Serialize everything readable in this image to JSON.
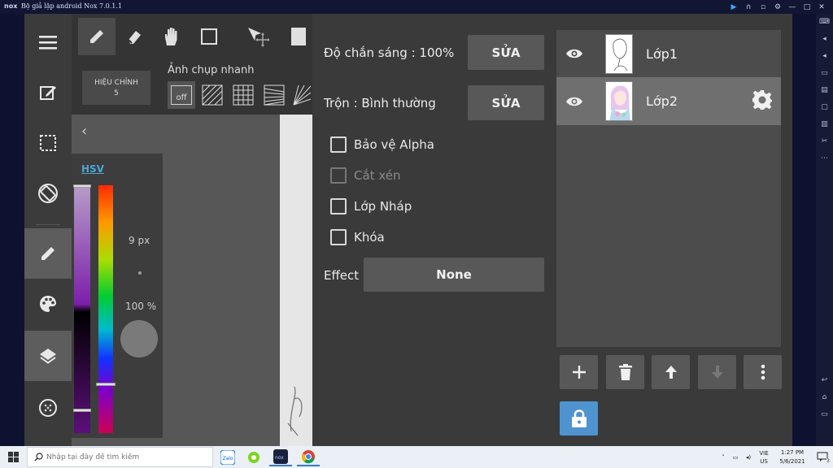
{
  "window": {
    "logo": "nox",
    "title": "Bộ giả lập android Nox 7.0.1.1"
  },
  "toolbar": {
    "fix_label_line1": "HIỆU CHỈNH",
    "fix_label_line2": "5",
    "snapshot_label": "Ảnh chụp nhanh",
    "snap_off": "off"
  },
  "color_panel": {
    "hsv_label": "HSV",
    "brush_size": "9 px",
    "opacity": "100 %"
  },
  "layer_props": {
    "opacity_label": "Độ chắn sáng : 100%",
    "opacity_edit": "SỬA",
    "blend_label": "Trộn : Bình thường",
    "blend_edit": "SỬA",
    "checkboxes": [
      {
        "label": "Bảo vệ Alpha",
        "checked": false,
        "enabled": true
      },
      {
        "label": "Cắt xén",
        "checked": false,
        "enabled": false
      },
      {
        "label": "Lớp Nháp",
        "checked": false,
        "enabled": true
      },
      {
        "label": "Khóa",
        "checked": false,
        "enabled": true
      }
    ],
    "effect_label": "Effect",
    "effect_value": "None"
  },
  "layers": [
    {
      "name": "Lớp1",
      "selected": false
    },
    {
      "name": "Lớp2",
      "selected": true
    }
  ],
  "taskbar": {
    "search_placeholder": "Nhập tại đây để tìm kiếm",
    "lang_line1": "VIE",
    "lang_line2": "US",
    "time": "1:27 PM",
    "date": "5/6/2021",
    "notification_count": "3"
  },
  "colors": {
    "accent_blue": "#4f93cf",
    "hsv_link": "#4aa8d8",
    "panel_bg": "#3a3a3a",
    "selected_row": "#6f6f6f"
  }
}
